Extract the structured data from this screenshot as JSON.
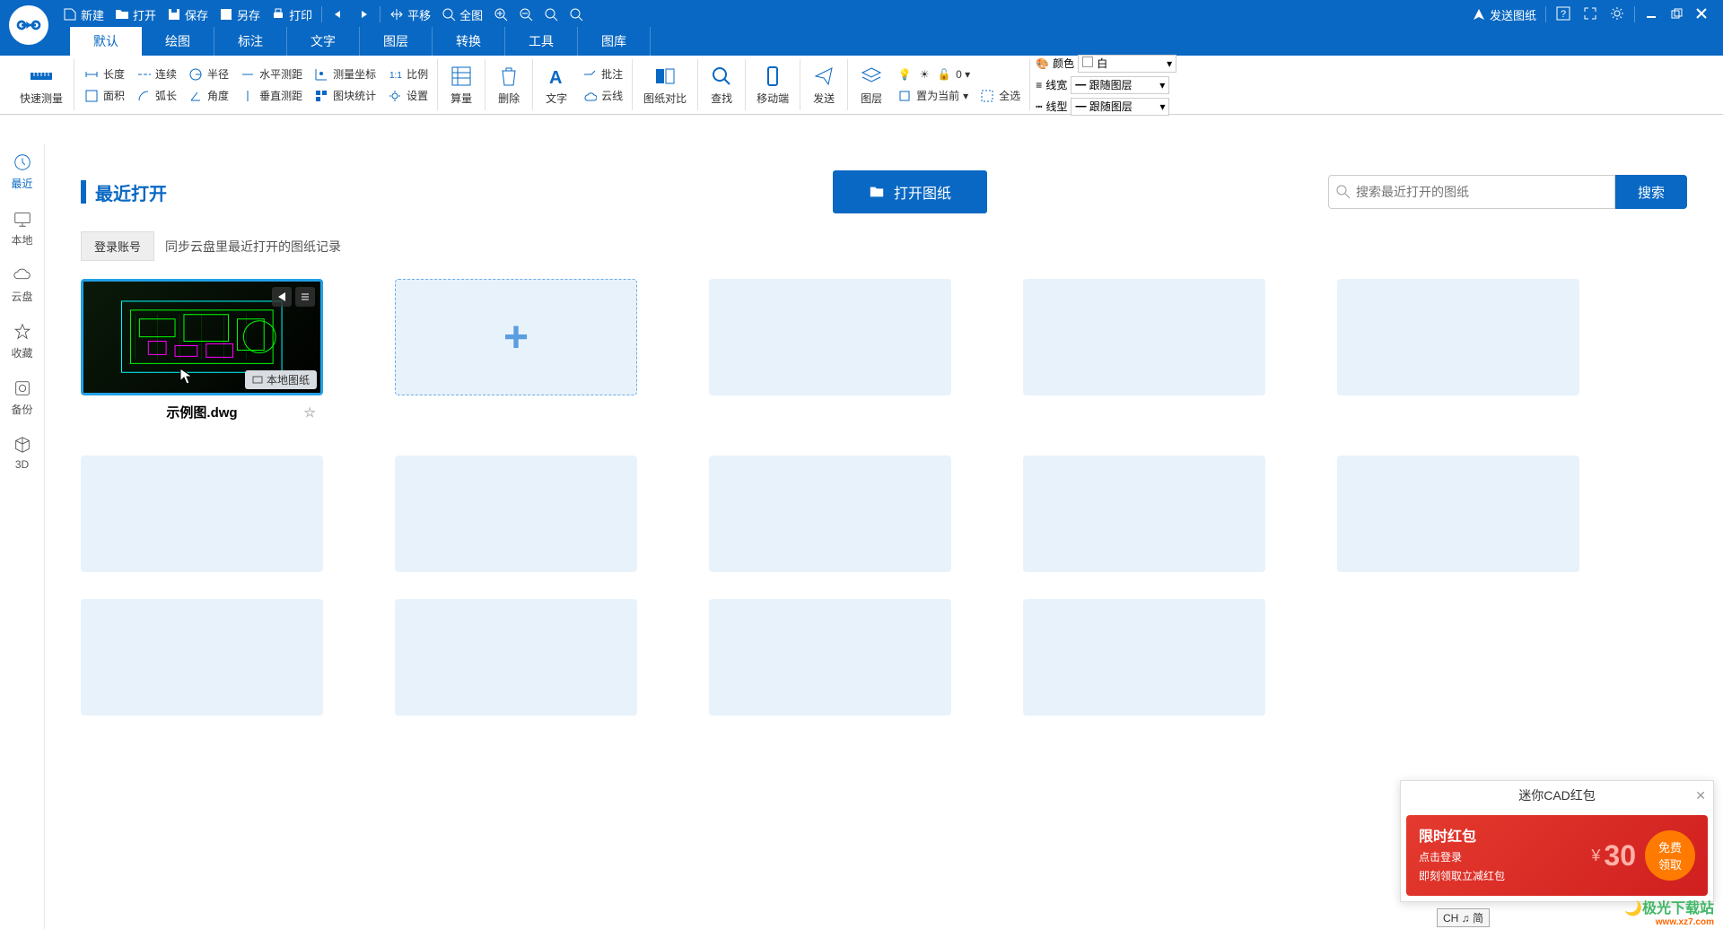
{
  "titlebar": {
    "new": "新建",
    "open": "打开",
    "save": "保存",
    "saveas": "另存",
    "print": "打印",
    "pan": "平移",
    "fit": "全图",
    "send": "发送图纸"
  },
  "tabs": [
    "默认",
    "绘图",
    "标注",
    "文字",
    "图层",
    "转换",
    "工具",
    "图库"
  ],
  "ribbon": {
    "quickmeasure": "快速测量",
    "measure": {
      "length": "长度",
      "continuous": "连续",
      "radius": "半径",
      "hdist": "水平测距",
      "area": "面积",
      "arclen": "弧长",
      "angle": "角度",
      "vdist": "垂直测距",
      "coord": "测量坐标",
      "blockstat": "图块统计",
      "scale": "比例",
      "settings": "设置"
    },
    "calc": "算量",
    "delete": "删除",
    "text": "文字",
    "cloud": "云线",
    "annotate": "批注",
    "compare": "图纸对比",
    "find": "查找",
    "mobile": "移动端",
    "send": "发送",
    "layer": "图层",
    "setcurrent": "置为当前",
    "selectall": "全选",
    "prop": {
      "color": "颜色",
      "color_v": "白",
      "lw": "线宽",
      "lw_v": "跟随图层",
      "lt": "线型",
      "lt_v": "跟随图层"
    }
  },
  "sidebar": [
    {
      "id": "recent",
      "label": "最近"
    },
    {
      "id": "local",
      "label": "本地"
    },
    {
      "id": "cloud",
      "label": "云盘"
    },
    {
      "id": "favorites",
      "label": "收藏"
    },
    {
      "id": "backup",
      "label": "备份"
    },
    {
      "id": "3d",
      "label": "3D"
    }
  ],
  "main": {
    "title": "最近打开",
    "open_btn": "打开图纸",
    "search_ph": "搜索最近打开的图纸",
    "search_btn": "搜索",
    "login_btn": "登录账号",
    "login_hint": "同步云盘里最近打开的图纸记录",
    "file1": "示例图.dwg",
    "file1_badge": "本地图纸"
  },
  "popup": {
    "title": "迷你CAD红包",
    "line1": "限时红包",
    "line2": "点击登录",
    "line3": "即刻领取立减红包",
    "amount": "30",
    "btn1": "免费",
    "btn2": "领取"
  },
  "ime": "CH ♫ 简",
  "watermark": "极光下载站",
  "watermark_url": "www.xz7.com"
}
